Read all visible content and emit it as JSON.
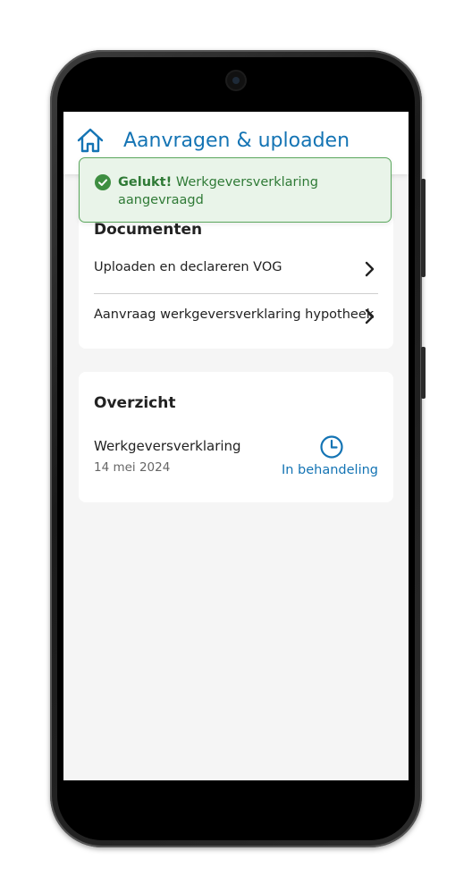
{
  "header": {
    "title": "Aanvragen & uploaden",
    "home_icon": "home-icon"
  },
  "toast": {
    "status": "success",
    "bold_text": "Gelukt!",
    "message_line1": "Werkgeversverklaring",
    "message_line2": "aangevraagd",
    "color": "#2f7a36",
    "background": "#e9f4e9"
  },
  "documents": {
    "title": "Documenten",
    "items": [
      {
        "label": "Uploaden en declareren VOG"
      },
      {
        "label": "Aanvraag werkgeversverklaring hypotheek"
      }
    ]
  },
  "overview": {
    "title": "Overzicht",
    "items": [
      {
        "name": "Werkgeversverklaring",
        "date": "14 mei 2024",
        "status": "In behandeling",
        "status_icon": "clock-icon"
      }
    ]
  },
  "colors": {
    "accent": "#1474b4",
    "screen_background": "#f5f5f5",
    "card_background": "#ffffff"
  }
}
